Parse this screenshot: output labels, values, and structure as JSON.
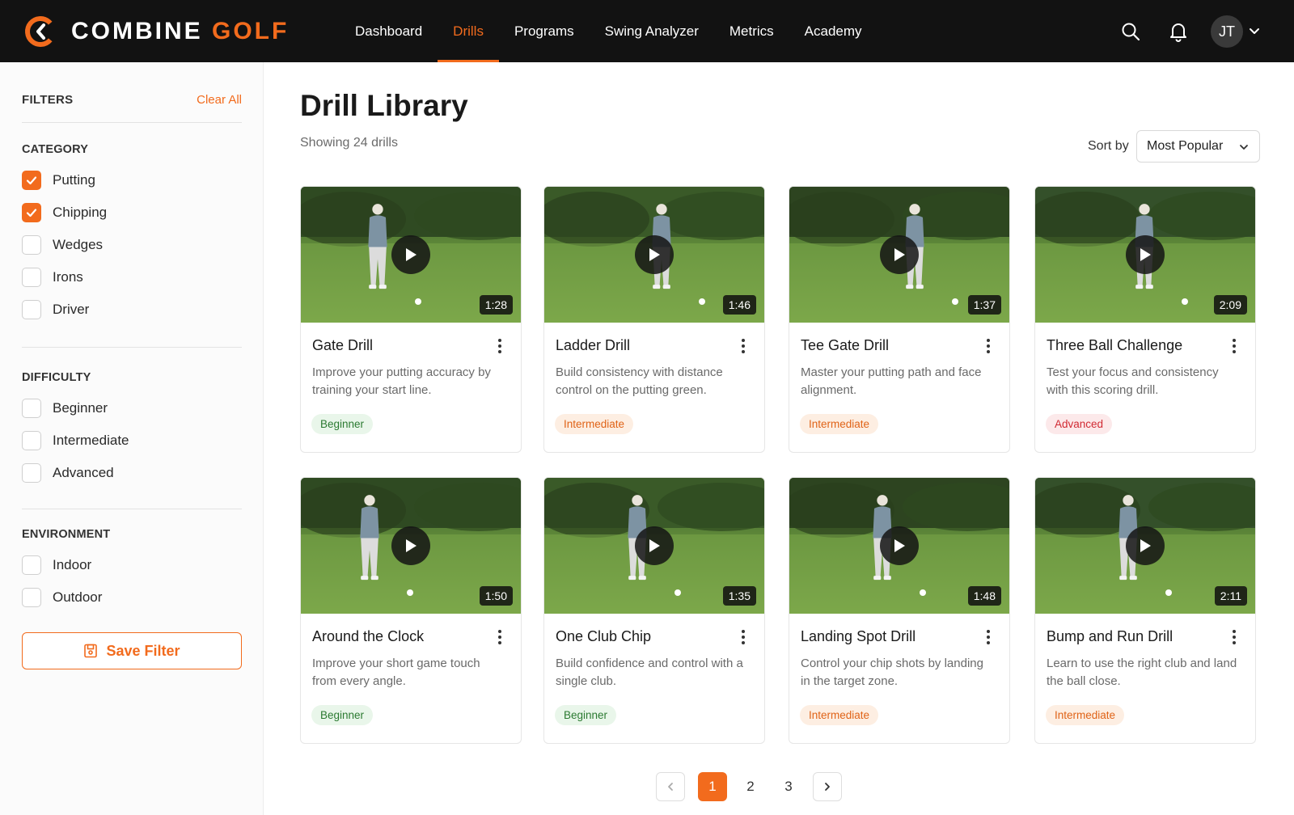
{
  "brand": {
    "name_part1": "COMBINE ",
    "name_part2": "GOLF"
  },
  "nav": {
    "items": [
      "Dashboard",
      "Drills",
      "Programs",
      "Swing Analyzer",
      "Metrics",
      "Academy"
    ],
    "active": "Drills"
  },
  "user": {
    "initials": "JT"
  },
  "colors": {
    "accent": "#f26b1d",
    "topbar": "#121212",
    "beginner": "#2b7a31",
    "intermediate": "#e06317",
    "advanced": "#d12a33"
  },
  "icons": {
    "search": "search-icon",
    "notifications": "bell-icon",
    "menu": "chevron-down-icon",
    "play": "play-icon",
    "more": "more-vertical-icon",
    "save": "bookmark-icon"
  },
  "sidebar": {
    "title": "FILTERS",
    "clear_all": "Clear All",
    "groups": [
      {
        "title": "CATEGORY",
        "options": [
          {
            "label": "Putting",
            "checked": true
          },
          {
            "label": "Chipping",
            "checked": true
          },
          {
            "label": "Wedges",
            "checked": false
          },
          {
            "label": "Irons",
            "checked": false
          },
          {
            "label": "Driver",
            "checked": false
          }
        ]
      },
      {
        "title": "DIFFICULTY",
        "options": [
          {
            "label": "Beginner",
            "checked": false
          },
          {
            "label": "Intermediate",
            "checked": false
          },
          {
            "label": "Advanced",
            "checked": false
          }
        ]
      },
      {
        "title": "ENVIRONMENT",
        "options": [
          {
            "label": "Indoor",
            "checked": false
          },
          {
            "label": "Outdoor",
            "checked": false
          }
        ]
      }
    ],
    "save_filter": "Save Filter"
  },
  "main": {
    "title": "Drill Library",
    "showing": "Showing 24 drills",
    "sort_label": "Sort by",
    "sort_value": "Most Popular",
    "drills": [
      {
        "title": "Gate Drill",
        "desc": "Improve your putting accuracy by training your start line.",
        "level": "Beginner",
        "duration": "1:28"
      },
      {
        "title": "Ladder Drill",
        "desc": "Build consistency with distance control on the putting green.",
        "level": "Intermediate",
        "duration": "1:46"
      },
      {
        "title": "Tee Gate Drill",
        "desc": "Master your putting path and face alignment.",
        "level": "Intermediate",
        "duration": "1:37"
      },
      {
        "title": "Three Ball Challenge",
        "desc": "Test your focus and consistency with this scoring drill.",
        "level": "Advanced",
        "duration": "2:09"
      },
      {
        "title": "Around the Clock",
        "desc": "Improve your short game touch from every angle.",
        "level": "Beginner",
        "duration": "1:50"
      },
      {
        "title": "One Club Chip",
        "desc": "Build confidence and control with a single club.",
        "level": "Beginner",
        "duration": "1:35"
      },
      {
        "title": "Landing Spot Drill",
        "desc": "Control your chip shots by landing in the target zone.",
        "level": "Intermediate",
        "duration": "1:48"
      },
      {
        "title": "Bump and Run Drill",
        "desc": "Learn to use the right club and land the ball close.",
        "level": "Intermediate",
        "duration": "2:11"
      }
    ]
  },
  "pagination": {
    "pages": [
      "1",
      "2",
      "3"
    ],
    "current": "1"
  }
}
